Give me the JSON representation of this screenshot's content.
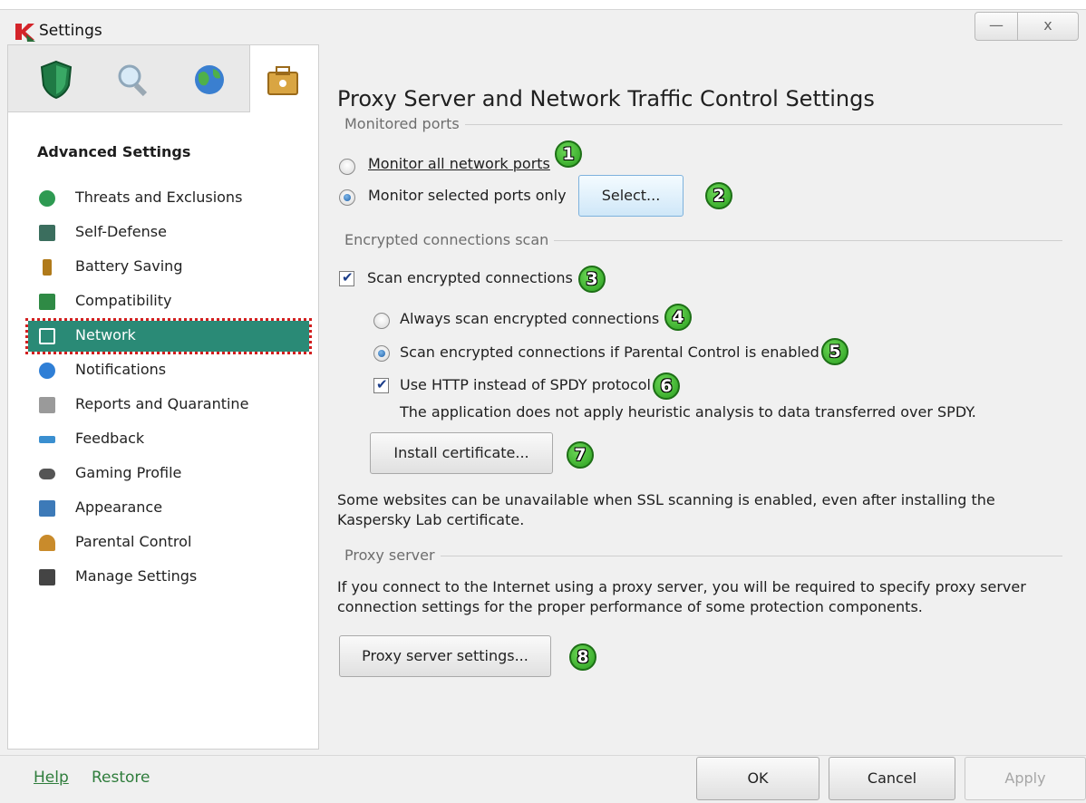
{
  "window": {
    "title": "Settings",
    "minimize": "—",
    "close": "x"
  },
  "sidebar": {
    "tab_icons": [
      "shield-icon",
      "search-icon",
      "globe-icon",
      "toolbox-icon"
    ],
    "heading": "Advanced Settings",
    "items": [
      {
        "label": "Threats and Exclusions",
        "icon": "check-circle-icon",
        "color": "#2e9a52"
      },
      {
        "label": "Self-Defense",
        "icon": "shield-k-icon",
        "color": "#3b6e5e"
      },
      {
        "label": "Battery Saving",
        "icon": "battery-icon",
        "color": "#b07a1a"
      },
      {
        "label": "Compatibility",
        "icon": "compatibility-check-icon",
        "color": "#2f8a45"
      },
      {
        "label": "Network",
        "icon": "network-icon",
        "color": "#ffffff"
      },
      {
        "label": "Notifications",
        "icon": "info-icon",
        "color": "#2f7fd6"
      },
      {
        "label": "Reports and Quarantine",
        "icon": "report-icon",
        "color": "#9a9a9a"
      },
      {
        "label": "Feedback",
        "icon": "arrows-icon",
        "color": "#3a8fd0"
      },
      {
        "label": "Gaming Profile",
        "icon": "gamepad-icon",
        "color": "#555555"
      },
      {
        "label": "Appearance",
        "icon": "window-icon",
        "color": "#3d7ab8"
      },
      {
        "label": "Parental Control",
        "icon": "parent-icon",
        "color": "#c98b2b"
      },
      {
        "label": "Manage Settings",
        "icon": "floppy-icon",
        "color": "#444444"
      }
    ],
    "active_index": 4,
    "help": "Help",
    "restore": "Restore"
  },
  "main": {
    "title": "Proxy Server and Network Traffic Control Settings",
    "monitored_ports": {
      "label": "Monitored ports",
      "all_ports": "Monitor all network ports",
      "selected_ports": "Monitor selected ports only",
      "selected_choice": "selected_ports",
      "select_button": "Select..."
    },
    "encrypted": {
      "label": "Encrypted connections scan",
      "scan_encrypted": "Scan encrypted connections",
      "scan_encrypted_checked": true,
      "always_scan": "Always scan encrypted connections",
      "scan_if_parental": "Scan encrypted connections if Parental Control is enabled",
      "selected_choice": "scan_if_parental",
      "use_http": "Use HTTP instead of SPDY protocol",
      "use_http_checked": true,
      "spdy_note": "The application does not apply heuristic analysis to data transferred over SPDY.",
      "install_cert": "Install certificate...",
      "ssl_note": "Some websites can be unavailable when SSL scanning is enabled, even after installing the Kaspersky Lab certificate."
    },
    "proxy": {
      "label": "Proxy server",
      "note": "If you connect to the Internet using a proxy server, you will be required to specify proxy server connection settings for the proper performance of some protection components.",
      "button": "Proxy server settings..."
    },
    "badges": [
      "1",
      "2",
      "3",
      "4",
      "5",
      "6",
      "7",
      "8"
    ]
  },
  "footer": {
    "ok": "OK",
    "cancel": "Cancel",
    "apply": "Apply"
  },
  "colors": {
    "accent": "#2a8a76",
    "highlight_border": "#d21f1f",
    "badge_green": "#2a9f1f",
    "link_green": "#2f7d3c"
  }
}
